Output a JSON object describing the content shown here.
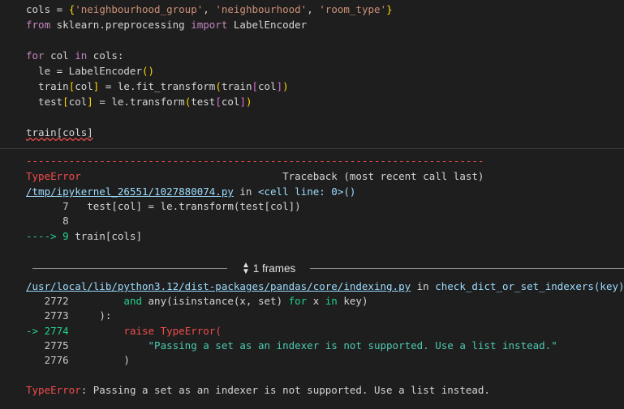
{
  "code": {
    "l1_a": "cols = ",
    "l1_b": "{",
    "l1_c": "'neighbourhood_group'",
    "l1_d": ", ",
    "l1_e": "'neighbourhood'",
    "l1_f": ", ",
    "l1_g": "'room_type'",
    "l1_h": "}",
    "l2_from": "from",
    "l2_mod": " sklearn.preprocessing ",
    "l2_import": "import",
    "l2_name": " LabelEncoder",
    "l4_for": "for",
    "l4_col": " col ",
    "l4_in": "in",
    "l4_rest": " cols:",
    "l5": "  le = LabelEncoder",
    "l5_p": "()",
    "l6_a": "  train",
    "l6_b": "[",
    "l6_c": "col",
    "l6_d": "]",
    "l6_e": " = le.fit_transform",
    "l6_f": "(",
    "l6_g": "train",
    "l6_h": "[",
    "l6_i": "col",
    "l6_j": "]",
    "l6_k": ")",
    "l7_a": "  test",
    "l7_b": "[",
    "l7_c": "col",
    "l7_d": "]",
    "l7_e": " = le.transform",
    "l7_f": "(",
    "l7_g": "test",
    "l7_h": "[",
    "l7_i": "col",
    "l7_j": "]",
    "l7_k": ")",
    "l9": "train[cols]"
  },
  "output": {
    "dashes": "---------------------------------------------------------------------------",
    "error_name": "TypeError",
    "traceback_header": "                                 Traceback (most recent call last)",
    "file1_link": "/tmp/ipykernel_26551/1027880074.py",
    "file1_in": " in ",
    "file1_loc": "<cell line: 0>()",
    "f1_l7_num": "      7",
    "f1_l7_code": "   test[col] = le.transform(test[col])",
    "f1_l8_num": "      8",
    "f1_l9_arrow": "----> 9",
    "f1_l9_code": " train[cols]",
    "frames_label": "1 frames",
    "file2_link": "/usr/local/lib/python3.12/dist-packages/pandas/core/indexing.py",
    "file2_in": " in ",
    "file2_loc": "check_dict_or_set_indexers(key)",
    "f2_2772_num": "   2772",
    "f2_2772_a": "         ",
    "f2_2772_and": "and",
    "f2_2772_b": " any(isinstance(x, set) ",
    "f2_2772_for": "for",
    "f2_2772_c": " x ",
    "f2_2772_in": "in",
    "f2_2772_d": " key)",
    "f2_2773_num": "   2773",
    "f2_2773_code": "     ):",
    "f2_2774_arrow": "-> 2774",
    "f2_2774_a": "         ",
    "f2_2774_raise": "raise",
    "f2_2774_b": " TypeError(",
    "f2_2775_num": "   2775",
    "f2_2775_code": "             \"Passing a set as an indexer is not supported. Use a list instead.\"",
    "f2_2776_num": "   2776",
    "f2_2776_code": "         )",
    "final_error_name": "TypeError",
    "final_error_msg": ": Passing a set as an indexer is not supported. Use a list instead."
  }
}
